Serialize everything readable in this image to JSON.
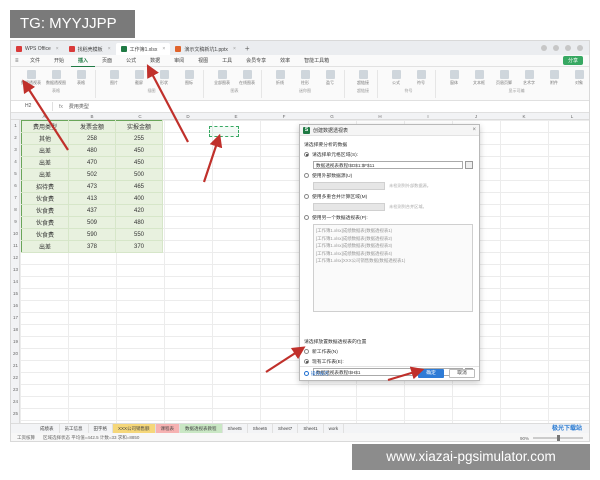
{
  "overlay": {
    "tg_label": "TG: MYYJJPP",
    "watermark": "www.xiazai-pgsimulator.com",
    "site_logo": "极光下载站"
  },
  "tabs": [
    {
      "label": "WPS Office",
      "color": "#d93a3a"
    },
    {
      "label": "找稻壳模板",
      "color": "#d93a3a"
    },
    {
      "label": "工作簿1.xlsx",
      "color": "#1f7a44",
      "active": true
    },
    {
      "label": "演示文稿新坑1.pptx",
      "color": "#e0632b"
    }
  ],
  "menu": {
    "file": "文件",
    "items": [
      "开始",
      "插入",
      "页面",
      "公式",
      "数据",
      "审阅",
      "视图",
      "工具",
      "会员专享",
      "效率",
      "智能工具箱"
    ],
    "active": "插入",
    "share": "分享"
  },
  "ribbon": {
    "groups": [
      {
        "name": "表格",
        "buttons": [
          "数据透视表",
          "数据透视图",
          "表格"
        ]
      },
      {
        "name": "插图",
        "buttons": [
          "图片",
          "截屏",
          "形状",
          "图标"
        ]
      },
      {
        "name": "图表",
        "buttons": [
          "全部图表",
          "在线图表"
        ]
      },
      {
        "name": "迷你图",
        "buttons": [
          "折线",
          "柱形",
          "盈亏"
        ]
      },
      {
        "name": "超链接",
        "buttons": [
          "超链接"
        ]
      },
      {
        "name": "符号",
        "buttons": [
          "公式",
          "符号"
        ]
      },
      {
        "name": "显示可编",
        "buttons": [
          "窗体",
          "文本框",
          "页眉页脚",
          "艺术字",
          "附件",
          "对象"
        ]
      }
    ]
  },
  "formula_bar": {
    "name_box": "H2",
    "fx": "fx",
    "value": "费用类型"
  },
  "columns": [
    "A",
    "B",
    "C",
    "D",
    "E",
    "F",
    "G",
    "H",
    "I",
    "J",
    "K",
    "L",
    "M"
  ],
  "rows": [
    "1",
    "2",
    "3",
    "4",
    "5",
    "6",
    "7",
    "8",
    "9",
    "10",
    "11",
    "12",
    "13",
    "14",
    "15",
    "16",
    "17",
    "18",
    "19",
    "20",
    "21",
    "22",
    "23",
    "24",
    "25"
  ],
  "table": {
    "headers": [
      "费用类型",
      "发票金额",
      "实报金额"
    ],
    "rows": [
      [
        "其他",
        "258",
        "255"
      ],
      [
        "出差",
        "480",
        "450"
      ],
      [
        "出差",
        "470",
        "450"
      ],
      [
        "出差",
        "502",
        "500"
      ],
      [
        "招待费",
        "473",
        "465"
      ],
      [
        "伙食费",
        "413",
        "400"
      ],
      [
        "伙食费",
        "437",
        "420"
      ],
      [
        "伙食费",
        "509",
        "480"
      ],
      [
        "伙食费",
        "590",
        "550"
      ],
      [
        "出差",
        "378",
        "370"
      ]
    ]
  },
  "dialog": {
    "title": "创建数据透视表",
    "section1": "请选择要分析的数据",
    "opt_range": "请选择单元格区域(S):",
    "range_value": "数据透视表教程!$D$1:$F$11",
    "opt_external": "使用外部数据源(U)",
    "external_hint": "未检测到外部数据源。",
    "opt_multi": "使用多重合并计算区域(M)",
    "multi_hint": "未检测到合并区域。",
    "opt_another": "使用另一个数据透视表(P):",
    "pivot_list": [
      "[工作簿1.xlsx]成绩数据表(数据透视表1)",
      "[工作簿1.xlsx]成绩数据表(数据透视表2)",
      "[工作簿1.xlsx]成绩数据表(数据透视表3)",
      "[工作簿1.xlsx]成绩数据表(数据透视表4)",
      "[工作簿1.xlsx]XXX公司销售数据(数据透视表1)"
    ],
    "section2": "请选择放置数据透视表的位置",
    "opt_new_sheet": "新工作表(N)",
    "opt_existing": "现有工作表(E):",
    "location_value": "数据透视表教程!$H$1",
    "help_tip": "操作技巧",
    "ok": "确定",
    "cancel": "取消"
  },
  "sheet_tabs": [
    {
      "label": "成绩表",
      "style": ""
    },
    {
      "label": "员工信息",
      "style": ""
    },
    {
      "label": "田字格",
      "style": ""
    },
    {
      "label": "XXX公司销售额",
      "style": "hl"
    },
    {
      "label": "课程表",
      "style": "pink"
    },
    {
      "label": "数据透视表教程",
      "style": "green"
    },
    {
      "label": "Sheet5",
      "style": ""
    },
    {
      "label": "Sheet6",
      "style": ""
    },
    {
      "label": "Sheet7",
      "style": ""
    },
    {
      "label": "Sheet1",
      "style": ""
    },
    {
      "label": "work",
      "style": ""
    }
  ],
  "status": {
    "mode": "工资核算",
    "stats": "区域选择状态  平均值=442.5  计数=33  求和=8850",
    "zoom": "90%"
  }
}
